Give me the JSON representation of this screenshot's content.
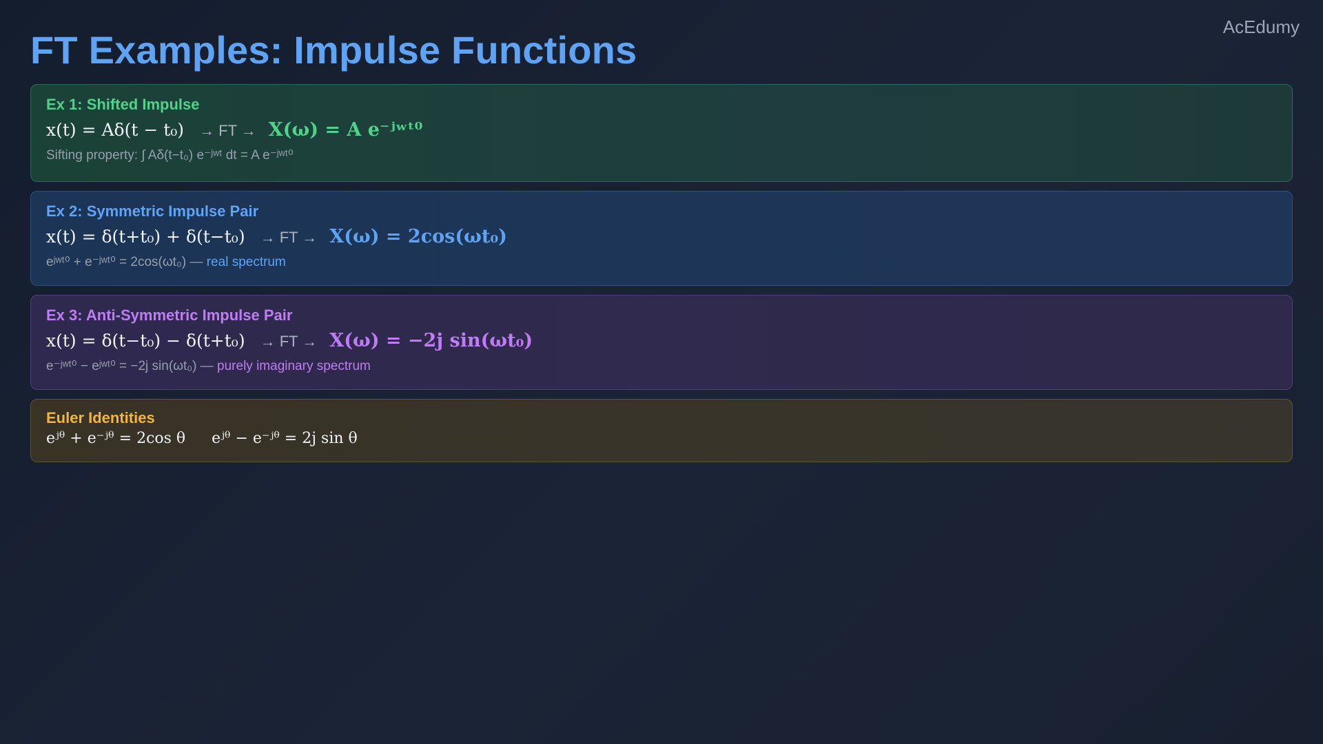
{
  "brand": "AcEdumy",
  "title": "FT Examples: Impulse Functions",
  "examples": [
    {
      "title": "Ex 1: Shifted Impulse",
      "signal": "x(t) = Aδ(t − t₀)",
      "arrow": "→ FT →",
      "transform": "X(ω) = A e⁻ʲʷᵗ⁰",
      "note": "Sifting property: ∫ Aδ(t−t₀) e⁻ʲʷᵗ dt = A e⁻ʲʷᵗ⁰",
      "note_highlight": ""
    },
    {
      "title": "Ex 2: Symmetric Impulse Pair",
      "signal": "x(t) = δ(t+t₀) + δ(t−t₀)",
      "arrow": "→ FT →",
      "transform": "X(ω) = 2cos(ωt₀)",
      "note": "eʲʷᵗ⁰ + e⁻ʲʷᵗ⁰ = 2cos(ωt₀) — ",
      "note_highlight": "real spectrum"
    },
    {
      "title": "Ex 3: Anti-Symmetric Impulse Pair",
      "signal": "x(t) = δ(t−t₀) − δ(t+t₀)",
      "arrow": "→ FT →",
      "transform": "X(ω) = −2j sin(ωt₀)",
      "note": "e⁻ʲʷᵗ⁰ − eʲʷᵗ⁰ = −2j sin(ωt₀) — ",
      "note_highlight": "purely imaginary spectrum"
    }
  ],
  "euler": {
    "title": "Euler Identities",
    "identity1": "eʲᶿ + e⁻ʲᶿ = 2cos θ",
    "identity2": "eʲᶿ − e⁻ʲᶿ = 2j sin θ"
  }
}
